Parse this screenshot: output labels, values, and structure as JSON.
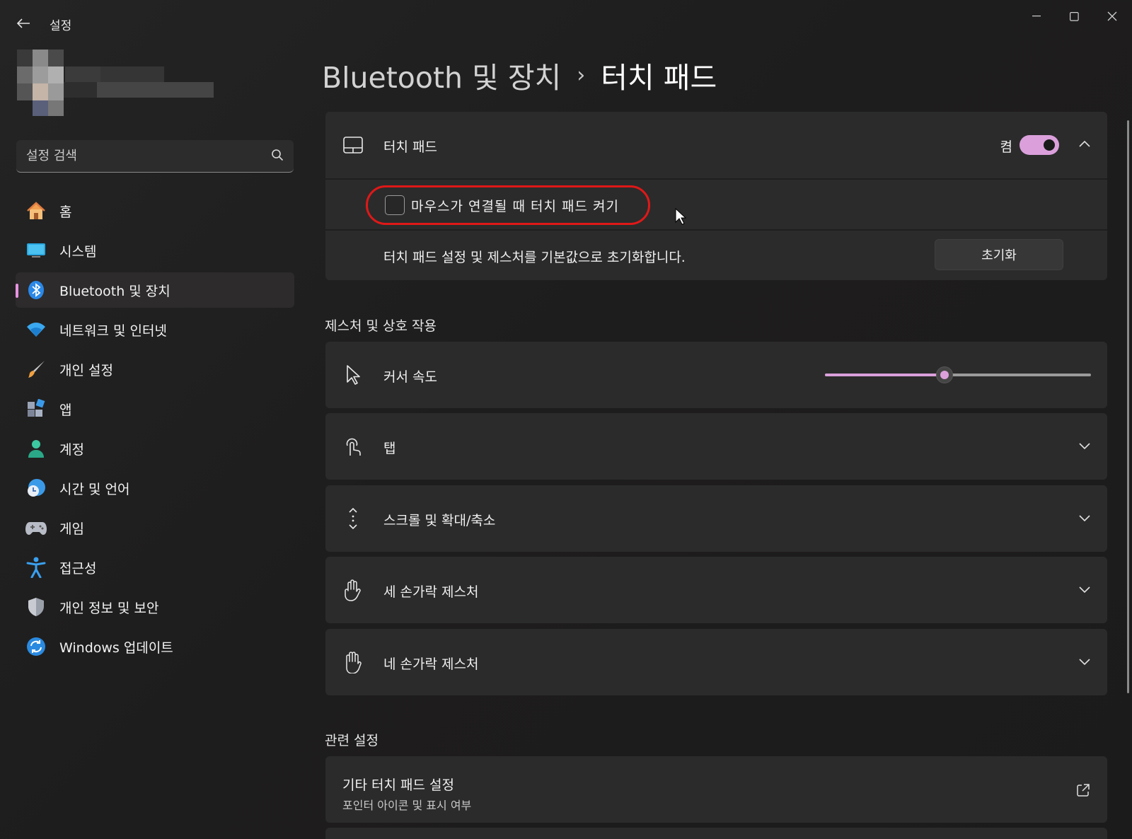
{
  "window": {
    "title": "설정",
    "back_icon": "back-arrow-icon",
    "minimize_icon": "minimize-icon",
    "maximize_icon": "maximize-icon",
    "close_icon": "close-icon"
  },
  "search": {
    "placeholder": "설정 검색",
    "icon": "search-icon"
  },
  "sidebar": {
    "items": [
      {
        "label": "홈",
        "icon": "home-icon",
        "active": false
      },
      {
        "label": "시스템",
        "icon": "system-display-icon",
        "active": false
      },
      {
        "label": "Bluetooth 및 장치",
        "icon": "bluetooth-icon",
        "active": true
      },
      {
        "label": "네트워크 및 인터넷",
        "icon": "wifi-icon",
        "active": false
      },
      {
        "label": "개인 설정",
        "icon": "brush-icon",
        "active": false
      },
      {
        "label": "앱",
        "icon": "apps-icon",
        "active": false
      },
      {
        "label": "계정",
        "icon": "account-icon",
        "active": false
      },
      {
        "label": "시간 및 언어",
        "icon": "clock-globe-icon",
        "active": false
      },
      {
        "label": "게임",
        "icon": "gamepad-icon",
        "active": false
      },
      {
        "label": "접근성",
        "icon": "accessibility-icon",
        "active": false
      },
      {
        "label": "개인 정보 및 보안",
        "icon": "shield-icon",
        "active": false
      },
      {
        "label": "Windows 업데이트",
        "icon": "update-icon",
        "active": false
      }
    ]
  },
  "breadcrumb": {
    "parent": "Bluetooth 및 장치",
    "separator": "›",
    "current": "터치 패드"
  },
  "touchpad": {
    "label": "터치 패드",
    "state_label": "켬",
    "toggle_on": true,
    "mouse_checkbox_label": "마우스가 연결될 때 터치 패드 켜기",
    "mouse_checkbox_checked": false,
    "reset_description": "터치 패드 설정 및 제스처를 기본값으로 초기화합니다.",
    "reset_button": "초기화"
  },
  "gestures": {
    "section_title": "제스처 및 상호 작용",
    "cursor_speed_label": "커서 속도",
    "cursor_speed_value": 0.45,
    "items": [
      {
        "label": "탭",
        "icon": "tap-icon"
      },
      {
        "label": "스크롤 및 확대/축소",
        "icon": "scroll-icon"
      },
      {
        "label": "세 손가락 제스처",
        "icon": "three-finger-icon"
      },
      {
        "label": "네 손가락 제스처",
        "icon": "four-finger-icon"
      }
    ]
  },
  "related": {
    "section_title": "관련 설정",
    "more_title": "기타 터치 패드 설정",
    "more_subtitle": "포인터 아이콘 및 표시 여부"
  },
  "colors": {
    "accent": "#dba0dc",
    "highlight_ring": "#e01818",
    "card_bg": "#2b2b2b"
  }
}
